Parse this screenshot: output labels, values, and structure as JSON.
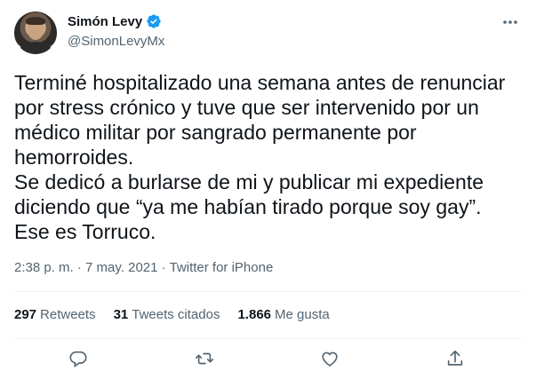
{
  "user": {
    "name": "Simón Levy",
    "handle": "@SimonLevyMx"
  },
  "tweet": {
    "text": "Terminé hospitalizado una semana antes de renunciar\npor stress crónico y tuve que ser intervenido por un\nmédico militar por sangrado permanente por\nhemorroides.\nSe dedicó a burlarse de mi y publicar mi expediente\ndiciendo que “ya me habían tirado porque soy gay”.\nEse es Torruco."
  },
  "meta": {
    "time": "2:38 p. m.",
    "separator": "·",
    "date": "7 may. 2021",
    "source": "Twitter for iPhone"
  },
  "stats": {
    "retweets_count": "297",
    "retweets_label": "Retweets",
    "quotes_count": "31",
    "quotes_label": "Tweets citados",
    "likes_count": "1.866",
    "likes_label": "Me gusta"
  },
  "colors": {
    "text": "#0f1419",
    "secondary": "#536471",
    "verified": "#1d9bf0",
    "divider": "#eff3f4"
  },
  "icons": [
    "verified-badge-icon",
    "more-icon",
    "reply-icon",
    "retweet-icon",
    "like-icon",
    "share-icon"
  ]
}
